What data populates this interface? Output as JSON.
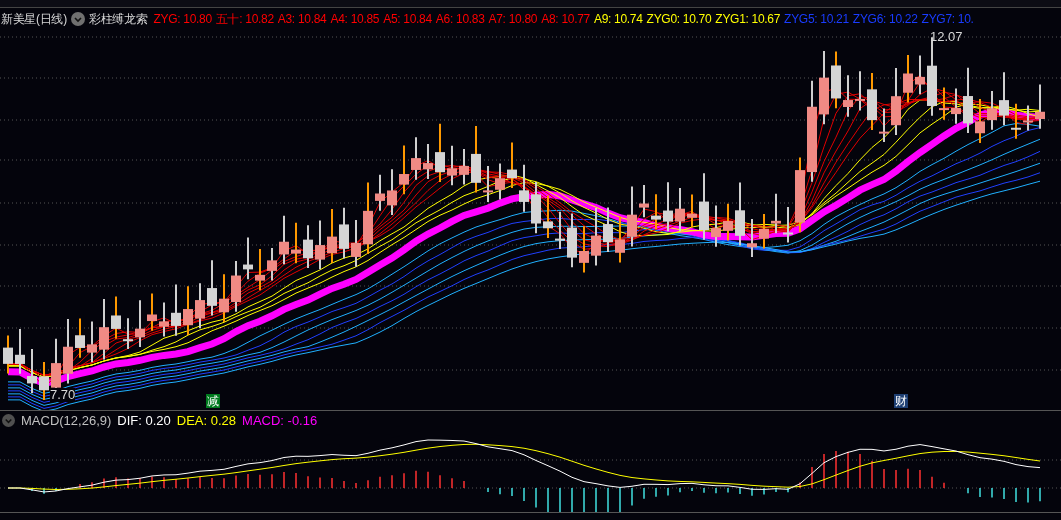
{
  "title": "新美星(日线)",
  "indicator": "彩柱缚龙索",
  "legend": [
    {
      "label": "ZYG: 10.80",
      "color": "#ff0000"
    },
    {
      "label": "五十: 10.82",
      "color": "#ff0000"
    },
    {
      "label": "A3: 10.84",
      "color": "#ff0000"
    },
    {
      "label": "A4: 10.85",
      "color": "#ff0000"
    },
    {
      "label": "A5: 10.84",
      "color": "#ff0000"
    },
    {
      "label": "A6: 10.83",
      "color": "#ff0000"
    },
    {
      "label": "A7: 10.80",
      "color": "#ff0000"
    },
    {
      "label": "A8: 10.77",
      "color": "#ff0000"
    },
    {
      "label": "A9: 10.74",
      "color": "#ffff00"
    },
    {
      "label": "ZYG0: 10.70",
      "color": "#ffff00"
    },
    {
      "label": "ZYG1: 10.67",
      "color": "#ffff00"
    },
    {
      "label": "ZYG5: 10.21",
      "color": "#1a3cff"
    },
    {
      "label": "ZYG6: 10.22",
      "color": "#1a3cff"
    },
    {
      "label": "ZYG7: 10.",
      "color": "#1a3cff"
    }
  ],
  "high_label": "12.07",
  "low_label": "7.70",
  "markers": [
    {
      "text": "减",
      "color": "#007a1e"
    },
    {
      "text": "财",
      "color": "#1e3f73"
    }
  ],
  "macd": {
    "name": "MACD(12,26,9)",
    "values": [
      {
        "label": "DIF: 0.20",
        "color": "#ffffff"
      },
      {
        "label": "DEA: 0.28",
        "color": "#ffff00"
      },
      {
        "label": "MACD: -0.16",
        "color": "#ff00ff"
      }
    ]
  }
}
